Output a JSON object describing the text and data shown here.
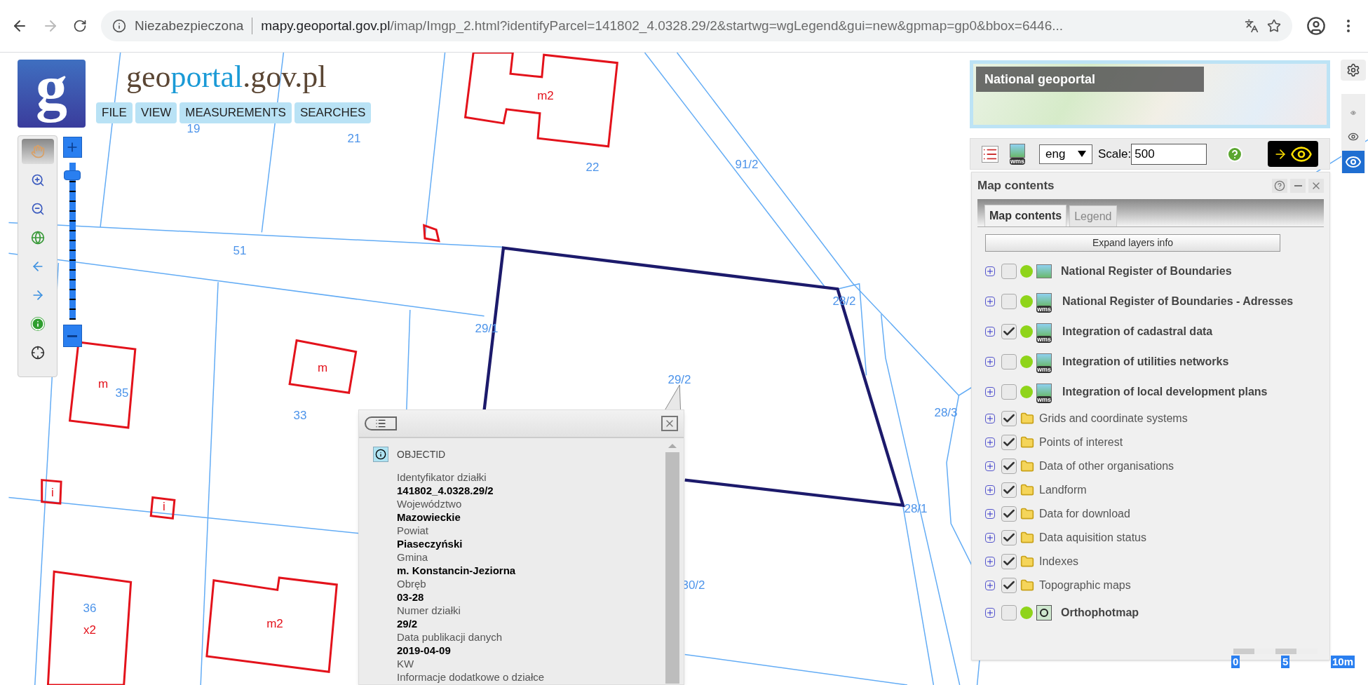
{
  "browser": {
    "back_disabled": false,
    "forward_disabled": true,
    "security_label": "Niezabezpieczona",
    "url_host": "mapy.geoportal.gov.pl",
    "url_path": "/imap/Imgp_2.html?identifyParcel=141802_4.0328.29/2&startwg=wgLegend&gui=new&gpmap=gp0&bbox=6446..."
  },
  "logo": {
    "letter": "g",
    "wordmark": [
      {
        "text": "geo",
        "highlight": false
      },
      {
        "text": "portal",
        "highlight": true
      },
      {
        "text": ".gov.pl",
        "highlight": false
      }
    ]
  },
  "menu": [
    "FILE",
    "VIEW",
    "MEASUREMENTS",
    "SEARCHES"
  ],
  "tools": [
    {
      "kind": "pan",
      "selected": true
    },
    {
      "kind": "zoom-in",
      "selected": false
    },
    {
      "kind": "zoom-out",
      "selected": false
    },
    {
      "kind": "full-extent",
      "selected": false
    },
    {
      "kind": "previous",
      "selected": false
    },
    {
      "kind": "next",
      "selected": false
    },
    {
      "kind": "identify",
      "selected": false
    },
    {
      "kind": "clear",
      "selected": false
    }
  ],
  "zoom_slider": {
    "level": 0.92
  },
  "map_labels": [
    {
      "text": "19",
      "kind": "parcel"
    },
    {
      "text": "21",
      "kind": "parcel"
    },
    {
      "text": "m2",
      "kind": "building"
    },
    {
      "text": "22",
      "kind": "parcel"
    },
    {
      "text": "91/2",
      "kind": "parcel"
    },
    {
      "text": "51",
      "kind": "parcel"
    },
    {
      "text": "29/1",
      "kind": "parcel"
    },
    {
      "text": "28/2",
      "kind": "parcel"
    },
    {
      "text": "m",
      "kind": "building"
    },
    {
      "text": "35",
      "kind": "parcel"
    },
    {
      "text": "m",
      "kind": "building"
    },
    {
      "text": "29/2",
      "kind": "parcel"
    },
    {
      "text": "33",
      "kind": "parcel"
    },
    {
      "text": "28/3",
      "kind": "parcel"
    },
    {
      "text": "i",
      "kind": "building"
    },
    {
      "text": "i",
      "kind": "building"
    },
    {
      "text": "28/1",
      "kind": "parcel"
    },
    {
      "text": "30/2",
      "kind": "parcel"
    },
    {
      "text": "36",
      "kind": "parcel"
    },
    {
      "text": "x2",
      "kind": "building"
    },
    {
      "text": "m2",
      "kind": "building"
    }
  ],
  "overview": {
    "title": "National geoportal"
  },
  "view_buttons": [
    {
      "selected": false
    },
    {
      "selected": false
    },
    {
      "selected": true
    }
  ],
  "toolbar": {
    "wms_badge": "wms",
    "language": "eng",
    "scale_label": "Scale:",
    "scale_value": "500"
  },
  "map_contents": {
    "title": "Map contents",
    "tabs": [
      {
        "label": "Map contents",
        "selected": true
      },
      {
        "label": "Legend",
        "selected": false
      }
    ],
    "expand_button": "Expand layers info",
    "layers": [
      {
        "label": "National Register of Boundaries",
        "kind": "service",
        "checked": false
      },
      {
        "label": "National Register of Boundaries - Adresses",
        "kind": "wms",
        "badge": "wms",
        "checked": false
      },
      {
        "label": "Integration of cadastral data",
        "kind": "wms",
        "badge": "wms",
        "checked": true
      },
      {
        "label": "Integration of utilities networks",
        "kind": "wms",
        "badge": "wms",
        "checked": false
      },
      {
        "label": "Integration of local development plans",
        "kind": "wms",
        "badge": "wms",
        "checked": false
      },
      {
        "label": "Grids and coordinate systems",
        "kind": "group",
        "checked": true
      },
      {
        "label": "Points of interest",
        "kind": "group",
        "checked": true
      },
      {
        "label": "Data of other organisations",
        "kind": "group",
        "checked": true
      },
      {
        "label": "Landform",
        "kind": "group",
        "checked": true
      },
      {
        "label": "Data for download",
        "kind": "group",
        "checked": true
      },
      {
        "label": "Data aquisition status",
        "kind": "group",
        "checked": true
      },
      {
        "label": "Indexes",
        "kind": "group",
        "checked": true
      },
      {
        "label": "Topographic maps",
        "kind": "group",
        "checked": true
      },
      {
        "label": "Orthophotmap",
        "kind": "cache",
        "checked": false
      }
    ]
  },
  "scale_bar": [
    "0",
    "5",
    "10m"
  ],
  "popup": {
    "heading": "OBJECTID",
    "fields": [
      {
        "label": "Identyfikator działki",
        "value": "141802_4.0328.29/2"
      },
      {
        "label": "Województwo",
        "value": "Mazowieckie"
      },
      {
        "label": "Powiat",
        "value": "Piaseczyński"
      },
      {
        "label": "Gmina",
        "value": "m. Konstancin-Jeziorna"
      },
      {
        "label": "Obręb",
        "value": "03-28"
      },
      {
        "label": "Numer działki",
        "value": "29/2"
      },
      {
        "label": "Data publikacji danych",
        "value": "2019-04-09"
      },
      {
        "label": "KW"
      },
      {
        "label": "Informacje dodatkowe o działce"
      }
    ]
  }
}
